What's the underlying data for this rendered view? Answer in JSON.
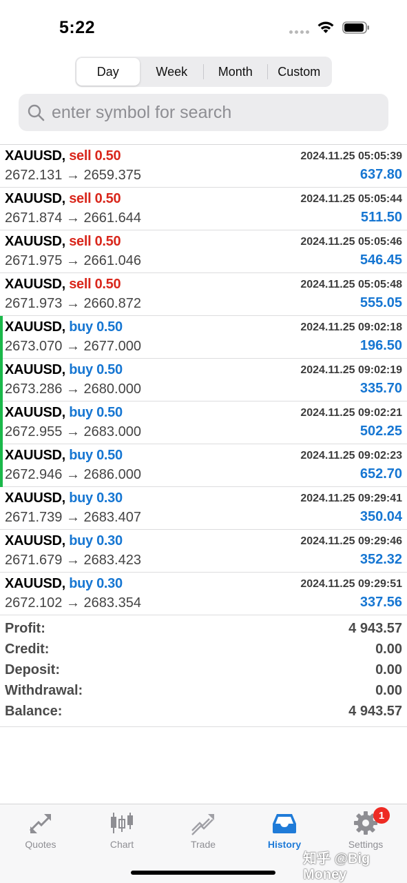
{
  "status_bar": {
    "time": "5:22"
  },
  "segments": [
    {
      "label": "Day",
      "active": true
    },
    {
      "label": "Week",
      "active": false
    },
    {
      "label": "Month",
      "active": false
    },
    {
      "label": "Custom",
      "active": false
    }
  ],
  "search": {
    "placeholder": "enter symbol for search"
  },
  "deals": [
    {
      "symbol": "XAUUSD,",
      "side": "sell 0.50",
      "type": "sell",
      "datetime": "2024.11.25 05:05:39",
      "prices": "2672.131 → 2659.375",
      "profit": "637.80"
    },
    {
      "symbol": "XAUUSD,",
      "side": "sell 0.50",
      "type": "sell",
      "datetime": "2024.11.25 05:05:44",
      "prices": "2671.874 → 2661.644",
      "profit": "511.50"
    },
    {
      "symbol": "XAUUSD,",
      "side": "sell 0.50",
      "type": "sell",
      "datetime": "2024.11.25 05:05:46",
      "prices": "2671.975 → 2661.046",
      "profit": "546.45"
    },
    {
      "symbol": "XAUUSD,",
      "side": "sell 0.50",
      "type": "sell",
      "datetime": "2024.11.25 05:05:48",
      "prices": "2671.973 → 2660.872",
      "profit": "555.05"
    },
    {
      "symbol": "XAUUSD,",
      "side": "buy 0.50",
      "type": "buy",
      "datetime": "2024.11.25 09:02:18",
      "prices": "2673.070 → 2677.000",
      "profit": "196.50",
      "marker": true
    },
    {
      "symbol": "XAUUSD,",
      "side": "buy 0.50",
      "type": "buy",
      "datetime": "2024.11.25 09:02:19",
      "prices": "2673.286 → 2680.000",
      "profit": "335.70",
      "marker": true
    },
    {
      "symbol": "XAUUSD,",
      "side": "buy 0.50",
      "type": "buy",
      "datetime": "2024.11.25 09:02:21",
      "prices": "2672.955 → 2683.000",
      "profit": "502.25",
      "marker": true
    },
    {
      "symbol": "XAUUSD,",
      "side": "buy 0.50",
      "type": "buy",
      "datetime": "2024.11.25 09:02:23",
      "prices": "2672.946 → 2686.000",
      "profit": "652.70",
      "marker": true
    },
    {
      "symbol": "XAUUSD,",
      "side": "buy 0.30",
      "type": "buy",
      "datetime": "2024.11.25 09:29:41",
      "prices": "2671.739 → 2683.407",
      "profit": "350.04"
    },
    {
      "symbol": "XAUUSD,",
      "side": "buy 0.30",
      "type": "buy",
      "datetime": "2024.11.25 09:29:46",
      "prices": "2671.679 → 2683.423",
      "profit": "352.32"
    },
    {
      "symbol": "XAUUSD,",
      "side": "buy 0.30",
      "type": "buy",
      "datetime": "2024.11.25 09:29:51",
      "prices": "2672.102 → 2683.354",
      "profit": "337.56"
    }
  ],
  "summary": [
    {
      "label": "Profit:",
      "value": "4 943.57"
    },
    {
      "label": "Credit:",
      "value": "0.00"
    },
    {
      "label": "Deposit:",
      "value": "0.00"
    },
    {
      "label": "Withdrawal:",
      "value": "0.00"
    },
    {
      "label": "Balance:",
      "value": "4 943.57"
    }
  ],
  "tabs": [
    {
      "label": "Quotes",
      "icon": "quotes-icon",
      "active": false
    },
    {
      "label": "Chart",
      "icon": "chart-icon",
      "active": false
    },
    {
      "label": "Trade",
      "icon": "trade-icon",
      "active": false
    },
    {
      "label": "History",
      "icon": "history-icon",
      "active": true
    },
    {
      "label": "Settings",
      "icon": "settings-icon",
      "active": false,
      "badge": "1"
    }
  ],
  "watermark": "知乎 @Big Money",
  "colors": {
    "sell": "#d9271c",
    "buy": "#1676d2",
    "active_tab": "#1f7bd8",
    "marker": "#1bb84a",
    "badge": "#ee2b24"
  }
}
